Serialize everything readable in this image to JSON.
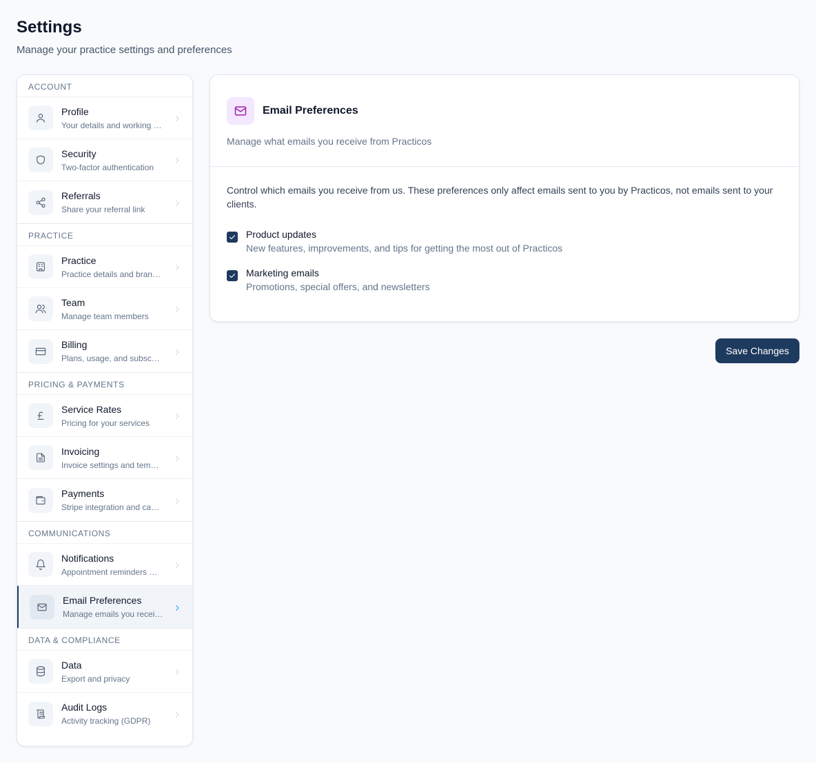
{
  "header": {
    "title": "Settings",
    "subtitle": "Manage your practice settings and preferences"
  },
  "sidebar": {
    "sections": [
      {
        "title": "ACCOUNT",
        "items": [
          {
            "label": "Profile",
            "desc": "Your details and working …",
            "icon": "user-icon"
          },
          {
            "label": "Security",
            "desc": "Two-factor authentication",
            "icon": "shield-icon"
          },
          {
            "label": "Referrals",
            "desc": "Share your referral link",
            "icon": "share-icon"
          }
        ]
      },
      {
        "title": "PRACTICE",
        "items": [
          {
            "label": "Practice",
            "desc": "Practice details and bran…",
            "icon": "building-icon"
          },
          {
            "label": "Team",
            "desc": "Manage team members",
            "icon": "users-icon"
          },
          {
            "label": "Billing",
            "desc": "Plans, usage, and subscri…",
            "icon": "credit-card-icon"
          }
        ]
      },
      {
        "title": "PRICING & PAYMENTS",
        "items": [
          {
            "label": "Service Rates",
            "desc": "Pricing for your services",
            "icon": "pound-icon"
          },
          {
            "label": "Invoicing",
            "desc": "Invoice settings and temp…",
            "icon": "file-text-icon"
          },
          {
            "label": "Payments",
            "desc": "Stripe integration and car…",
            "icon": "wallet-icon"
          }
        ]
      },
      {
        "title": "COMMUNICATIONS",
        "items": [
          {
            "label": "Notifications",
            "desc": "Appointment reminders a…",
            "icon": "bell-icon"
          },
          {
            "label": "Email Preferences",
            "desc": "Manage emails you recei…",
            "icon": "mail-icon",
            "active": true
          }
        ]
      },
      {
        "title": "DATA & COMPLIANCE",
        "items": [
          {
            "label": "Data",
            "desc": "Export and privacy",
            "icon": "database-icon"
          },
          {
            "label": "Audit Logs",
            "desc": "Activity tracking (GDPR)",
            "icon": "scroll-icon"
          }
        ]
      }
    ]
  },
  "card": {
    "title": "Email Preferences",
    "subtitle": "Manage what emails you receive from Practicos",
    "intro": "Control which emails you receive from us. These preferences only affect emails sent to you by Practicos, not emails sent to your clients.",
    "preferences": [
      {
        "label": "Product updates",
        "desc": "New features, improvements, and tips for getting the most out of Practicos",
        "checked": true
      },
      {
        "label": "Marketing emails",
        "desc": "Promotions, special offers, and newsletters",
        "checked": true
      }
    ]
  },
  "actions": {
    "save_label": "Save Changes"
  },
  "colors": {
    "primary": "#1e3a5f",
    "accent_icon_bg": "#f3e8ff",
    "accent_icon": "#a21caf",
    "active_chevron": "#0ea5e9"
  }
}
